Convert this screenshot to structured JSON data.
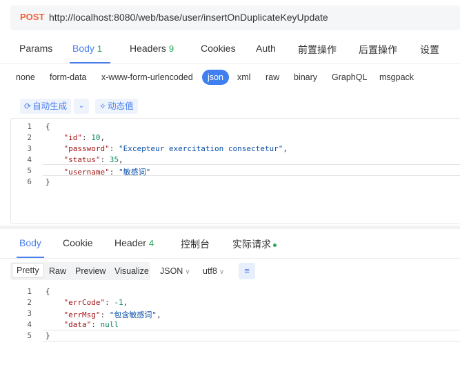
{
  "request": {
    "method": "POST",
    "url": "http://localhost:8080/web/base/user/insertOnDuplicateKeyUpdate"
  },
  "request_tabs": [
    {
      "label": "Params"
    },
    {
      "label": "Body",
      "count": "1",
      "active": true
    },
    {
      "label": "Headers",
      "count": "9"
    },
    {
      "label": "Cookies"
    },
    {
      "label": "Auth"
    },
    {
      "label": "前置操作"
    },
    {
      "label": "后置操作"
    },
    {
      "label": "设置"
    }
  ],
  "body_types": [
    "none",
    "form-data",
    "x-www-form-urlencoded",
    "json",
    "xml",
    "raw",
    "binary",
    "GraphQL",
    "msgpack"
  ],
  "body_type_selected": "json",
  "tools": {
    "auto_generate": "自动生成",
    "dynamic_value": "动态值"
  },
  "request_body": {
    "line_numbers": [
      "1",
      "2",
      "3",
      "4",
      "5",
      "6"
    ],
    "lines": {
      "l1": "{",
      "l2_key": "\"id\"",
      "l2_val": "10",
      "l3_key": "\"password\"",
      "l3_val": "\"Excepteur exercitation consectetur\"",
      "l4_key": "\"status\"",
      "l4_val": "35",
      "l5_key": "\"username\"",
      "l5_val": "\"敏感词\"",
      "l6": "}"
    }
  },
  "response_tabs": [
    {
      "label": "Body",
      "active": true
    },
    {
      "label": "Cookie"
    },
    {
      "label": "Header",
      "count": "4"
    },
    {
      "label": "控制台"
    },
    {
      "label": "实际请求"
    }
  ],
  "response_views": [
    "Pretty",
    "Raw",
    "Preview",
    "Visualize"
  ],
  "response_view_selected": "Pretty",
  "format_select": "JSON",
  "encoding_select": "utf8",
  "response_body": {
    "line_numbers": [
      "1",
      "2",
      "3",
      "4",
      "5"
    ],
    "lines": {
      "l1": "{",
      "l2_key": "\"errCode\"",
      "l2_val": "-1",
      "l3_key": "\"errMsg\"",
      "l3_val": "\"包含敏感词\"",
      "l4_key": "\"data\"",
      "l4_val": "null",
      "l5": "}"
    }
  },
  "colors": {
    "accent": "#4a7ff0",
    "method_post": "#f3633a",
    "count_green": "#29a85b"
  }
}
